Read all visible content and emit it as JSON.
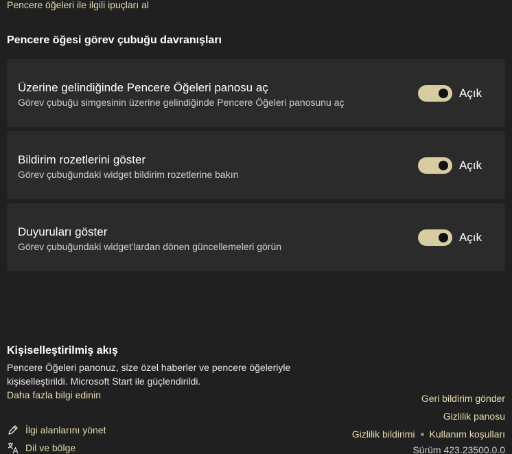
{
  "top_link": "Pencere öğeleri ile ilgili ipuçları al",
  "section_title": "Pencere öğesi görev çubuğu davranışları",
  "settings": [
    {
      "title": "Üzerine gelindiğinde Pencere Öğeleri panosu aç",
      "description": "Görev çubuğu simgesinin üzerine gelindiğinde Pencere Öğeleri panosunu aç",
      "state": "Açık",
      "on": true
    },
    {
      "title": "Bildirim rozetlerini göster",
      "description": "Görev çubuğundaki widget bildirim rozetlerine bakın",
      "state": "Açık",
      "on": true
    },
    {
      "title": "Duyuruları göster",
      "description": "Görev çubuğundaki widget'lardan dönen güncellemeleri görün",
      "state": "Açık",
      "on": true
    }
  ],
  "feed": {
    "title": "Kişiselleştirilmiş akış",
    "description": "Pencere Öğeleri panonuz, size özel haberler ve pencere öğeleriyle kişiselleştirildi. Microsoft Start ile güçlendirildi.",
    "learn_more": "Daha fazla bilgi edinin"
  },
  "actions": {
    "manage_interests": "İlgi alanlarını yönet",
    "language_region": "Dil ve bölge"
  },
  "right_links": {
    "feedback": "Geri bildirim gönder",
    "privacy_dashboard": "Gizlilik panosu",
    "privacy_statement": "Gizlilik bildirimi",
    "terms": "Kullanım koşulları"
  },
  "version": "Sürüm 423.23500.0.0",
  "colors": {
    "background": "#202020",
    "card": "#2b2b2b",
    "accent": "#d8cca1",
    "link": "#e8dcae"
  },
  "icons": {
    "manage_interests": "pencil-icon",
    "language_region": "language-icon"
  }
}
